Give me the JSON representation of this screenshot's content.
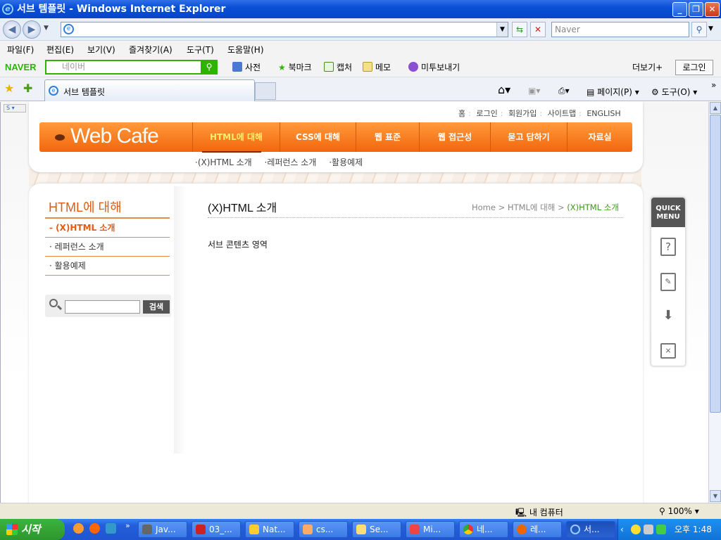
{
  "window": {
    "title": "서브 템플릿 - Windows Internet Explorer"
  },
  "addressbar": {
    "url": "",
    "search_placeholder": "Naver"
  },
  "menu": [
    "파일(F)",
    "편집(E)",
    "보기(V)",
    "즐겨찾기(A)",
    "도구(T)",
    "도움말(H)"
  ],
  "naverbar": {
    "logo": "NAVER",
    "search_placeholder": "네이버",
    "items": [
      "사전",
      "북마크",
      "캡처",
      "메모",
      "미투보내기"
    ],
    "more": "더보기+",
    "login": "로그인"
  },
  "tabs": {
    "active_label": "서브 템플릿",
    "tools": [
      "페이지(P)",
      "도구(O)"
    ]
  },
  "site": {
    "util_links": [
      "홈",
      "로그인",
      "회원가입",
      "사이트맵",
      "ENGLISH"
    ],
    "logo": "Web Cafe",
    "gnb": [
      "HTML에 대해",
      "CSS에 대해",
      "웹 표준",
      "웹 접근성",
      "묻고 답하기",
      "자료실"
    ],
    "sub_menu": [
      "·(X)HTML 소개",
      "·레퍼런스 소개",
      "·활용예제"
    ],
    "lnb": {
      "title": "HTML에 대해",
      "items": [
        "-  (X)HTML 소개",
        "·   레퍼런스 소개",
        "·   활용예제"
      ]
    },
    "search_button": "검색",
    "content": {
      "title": "(X)HTML 소개",
      "breadcrumb": [
        "Home",
        "HTML에 대해",
        "(X)HTML 소개"
      ],
      "body": "서브 콘텐츠 영역"
    },
    "quick_menu": {
      "title_line1": "QUICK",
      "title_line2": "MENU",
      "icons": [
        "question-icon",
        "memo-icon",
        "download-icon",
        "presentation-icon"
      ]
    }
  },
  "status": {
    "zone": "내 컴퓨터",
    "zoom": "100%"
  },
  "taskbar": {
    "start": "시작",
    "buttons": [
      "Jav...",
      "03_...",
      "Nat...",
      "cs...",
      "Se...",
      "Mi...",
      "네...",
      "레...",
      "서..."
    ],
    "clock": "오후 1:48"
  },
  "colors": {
    "accent": "#f2660d",
    "naver_green": "#2db400",
    "crumb_current": "#3a9a15",
    "lnb_title": "#e35b10"
  }
}
